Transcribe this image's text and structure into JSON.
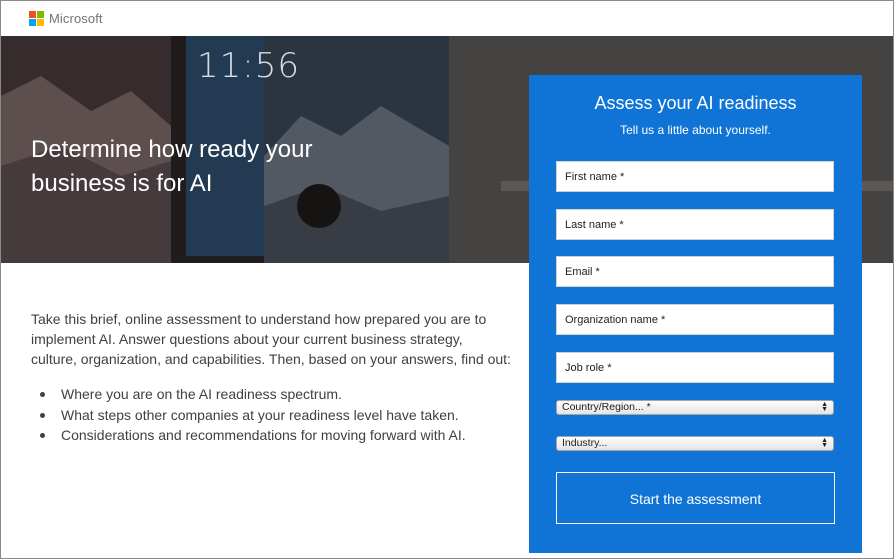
{
  "header": {
    "brand": "Microsoft",
    "logo_colors": [
      "#f25022",
      "#7fba00",
      "#00a4ef",
      "#ffb900"
    ]
  },
  "hero": {
    "title": "Determine how ready your business is for AI",
    "screen_clock": "11:56"
  },
  "intro": {
    "paragraph": "Take this brief, online assessment to understand how prepared you are to implement AI. Answer questions about your current business strategy, culture, organization, and capabilities. Then, based on your answers, find out:",
    "bullets": [
      "Where you are on the AI readiness spectrum.",
      "What steps other companies at your readiness level have taken.",
      "Considerations and recommendations for moving forward with AI."
    ]
  },
  "form": {
    "title": "Assess your AI readiness",
    "subtitle": "Tell us a little about yourself.",
    "first_name": "First name *",
    "last_name": "Last name *",
    "email": "Email *",
    "organization": "Organization name *",
    "job_role": "Job role *",
    "country": "Country/Region... *",
    "industry": "Industry...",
    "submit": "Start the assessment"
  },
  "colors": {
    "panel": "#0f74d6",
    "text": "#404040"
  }
}
